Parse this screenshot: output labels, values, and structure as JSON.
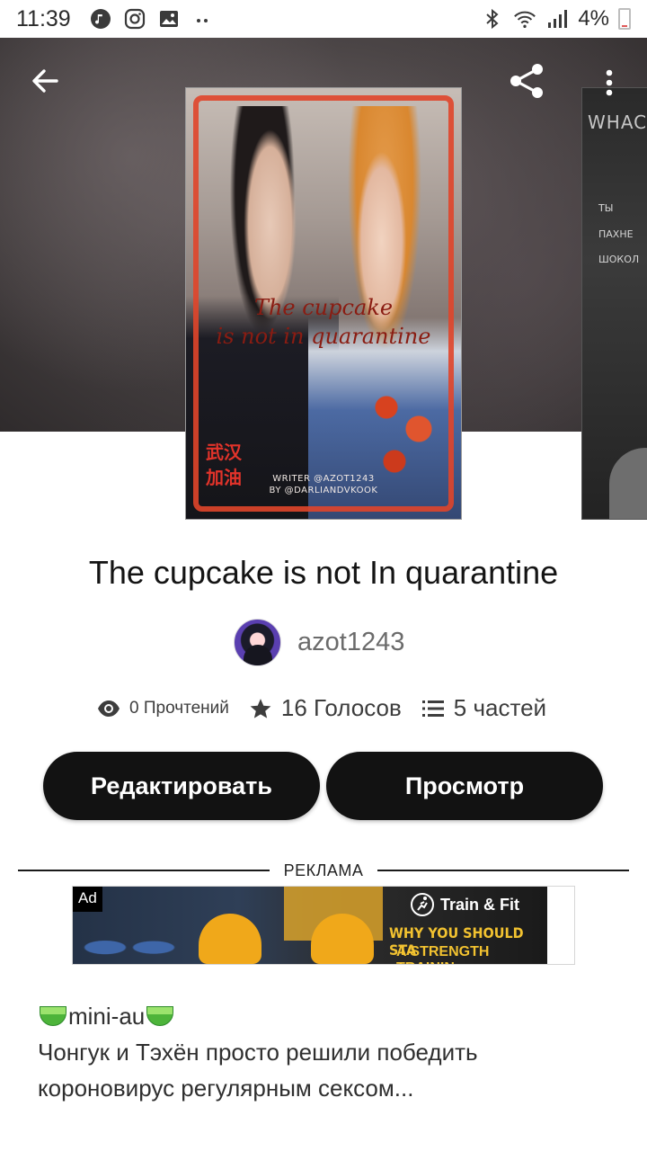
{
  "status_bar": {
    "time": "11:39",
    "battery": "4%"
  },
  "header": {
    "back_icon": "arrow-left-icon",
    "share_icon": "share-icon",
    "more_icon": "more-vertical-icon"
  },
  "cover": {
    "title_line1": "The cupcake",
    "title_line2": "is not in quarantine",
    "hanzi_line1": "武汉",
    "hanzi_line2": "加油",
    "credit_line1": "WRITER @AZOT1243",
    "credit_line2": "BY @DARLIANDVKOOK"
  },
  "next_cover": {
    "title": "WHAC",
    "lines": [
      "ТЫ",
      "ПАХНЕ",
      "ШОКОЛ"
    ]
  },
  "story": {
    "title": "The cupcake is not In quarantine",
    "author": "azot1243"
  },
  "stats": {
    "reads": "0 Прочтений",
    "votes": "16 Голосов",
    "parts": "5 частей"
  },
  "buttons": {
    "edit": "Редактировать",
    "preview": "Просмотр"
  },
  "ad": {
    "section_label": "РЕКЛАМА",
    "badge": "Ad",
    "brand": "Train & Fit",
    "headline1": "WHY YOU SHOULD STA",
    "headline2": "A STRENGTH TRAININ"
  },
  "description": {
    "line1": "mini-au",
    "line2": "Чонгук и Тэхён просто решили победить",
    "line3": "короновирус регулярным сексом..."
  },
  "colors": {
    "button_bg": "#121212",
    "cover_frame": "#e0452a",
    "ad_headline": "#f2c230"
  }
}
